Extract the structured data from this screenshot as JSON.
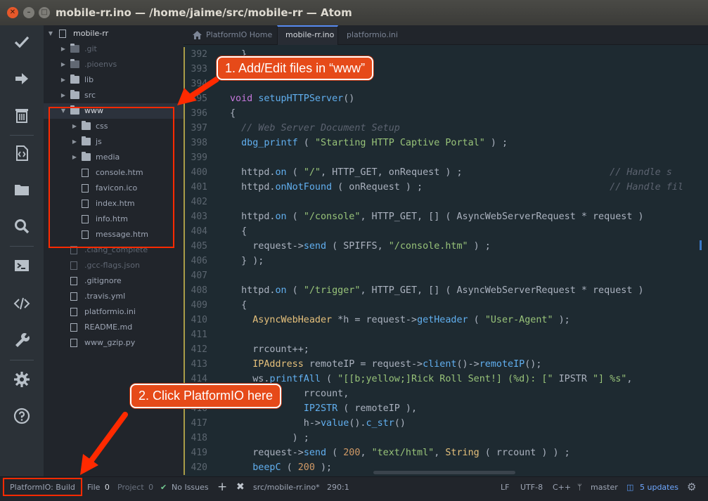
{
  "window": {
    "title": "mobile-rr.ino — /home/jaime/src/mobile-rr — Atom"
  },
  "toolbar": {
    "icons": [
      "check-icon",
      "arrow-right-icon",
      "trash-icon",
      "code-file-icon",
      "folder-icon",
      "search-icon",
      "terminal-icon",
      "code-brackets-icon",
      "wrench-icon",
      "gear-icon",
      "help-icon"
    ]
  },
  "tree": {
    "root": "mobile-rr",
    "items": [
      {
        "label": ".git",
        "type": "folder",
        "ignored": true
      },
      {
        "label": ".pioenvs",
        "type": "folder",
        "ignored": true
      },
      {
        "label": "lib",
        "type": "folder"
      },
      {
        "label": "src",
        "type": "folder"
      },
      {
        "label": "www",
        "type": "folder",
        "open": true
      },
      {
        "label": "css",
        "type": "folder"
      },
      {
        "label": "js",
        "type": "folder"
      },
      {
        "label": "media",
        "type": "folder"
      },
      {
        "label": "console.htm",
        "type": "file"
      },
      {
        "label": "favicon.ico",
        "type": "file"
      },
      {
        "label": "index.htm",
        "type": "file"
      },
      {
        "label": "info.htm",
        "type": "file"
      },
      {
        "label": "message.htm",
        "type": "file"
      },
      {
        "label": ".clang_complete",
        "type": "file",
        "ignored": true
      },
      {
        "label": ".gcc-flags.json",
        "type": "file",
        "ignored": true
      },
      {
        "label": ".gitignore",
        "type": "file"
      },
      {
        "label": ".travis.yml",
        "type": "file"
      },
      {
        "label": "platformio.ini",
        "type": "file"
      },
      {
        "label": "README.md",
        "type": "file"
      },
      {
        "label": "www_gzip.py",
        "type": "file"
      }
    ]
  },
  "tabs": [
    {
      "label": "PlatformIO Home",
      "active": false
    },
    {
      "label": "mobile-rr.ino",
      "active": true
    },
    {
      "label": "platformio.ini",
      "active": false
    }
  ],
  "editor": {
    "line_numbers": [
      "392",
      "393",
      "394",
      "395",
      "396",
      "397",
      "398",
      "399",
      "400",
      "401",
      "402",
      "403",
      "404",
      "405",
      "406",
      "407",
      "408",
      "409",
      "410",
      "411",
      "412",
      "413",
      "414",
      "415",
      "416",
      "417",
      "418",
      "419",
      "420"
    ],
    "lines": [
      "  }",
      "",
      "",
      "void setupHTTPServer()",
      "{",
      "  // Web Server Document Setup",
      "  dbg_printf ( \"Starting HTTP Captive Portal\" ) ;",
      "",
      "  httpd.on ( \"/\", HTTP_GET, onRequest ) ;                          // Handle s",
      "  httpd.onNotFound ( onRequest ) ;                                 // Handle fil",
      "",
      "  httpd.on ( \"/console\", HTTP_GET, [] ( AsyncWebServerRequest * request )",
      "  {",
      "    request->send ( SPIFFS, \"/console.htm\" ) ;",
      "  } );",
      "",
      "  httpd.on ( \"/trigger\", HTTP_GET, [] ( AsyncWebServerRequest * request )",
      "  {",
      "    AsyncWebHeader *h = request->getHeader ( \"User-Agent\" );",
      "",
      "    rrcount++;",
      "    IPAddress remoteIP = request->client()->remoteIP();",
      "    ws.printfAll ( \"[[b;yellow;]Rick Roll Sent!] (%d): [\" IPSTR \"] %s\",",
      "             rrcount,",
      "             IP2STR ( remoteIP ),",
      "             h->value().c_str()",
      "           ) ;",
      "    request->send ( 200, \"text/html\", String ( rrcount ) ) ;",
      "    beepC ( 200 );"
    ]
  },
  "status": {
    "build_button": "PlatformIO: Build",
    "file_label": "File",
    "file_count": "0",
    "project_label": "Project",
    "project_count": "0",
    "issues": "No Issues",
    "path": "src/mobile-rr.ino*",
    "cursor": "290:1",
    "line_ending": "LF",
    "encoding": "UTF-8",
    "grammar": "C++",
    "branch": "master",
    "updates": "5 updates"
  },
  "annotations": {
    "callout1": "1. Add/Edit files in “www”",
    "callout2": "2. Click PlatformIO here",
    "accent": "#e64a19"
  }
}
